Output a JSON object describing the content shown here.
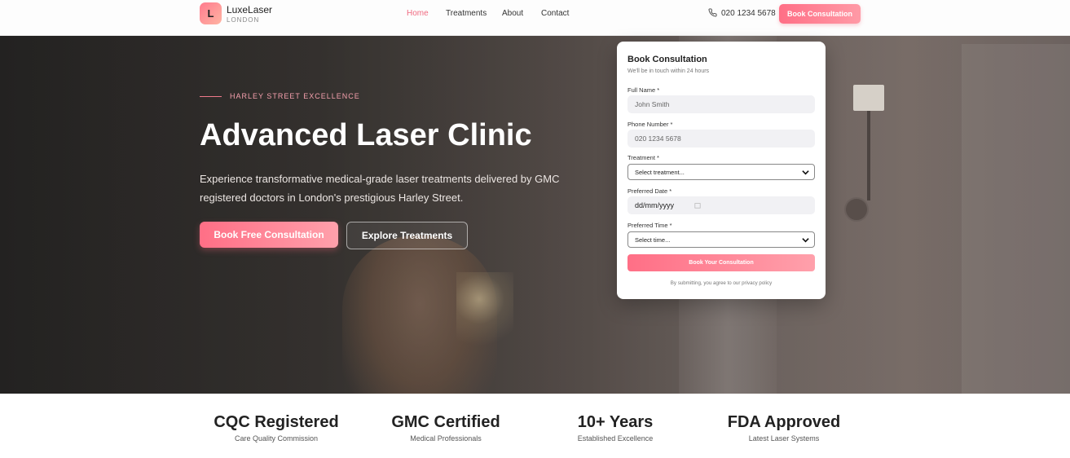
{
  "brand": {
    "logo_letter": "L",
    "name": "LuxeLaser",
    "location": "LONDON"
  },
  "nav": [
    {
      "label": "Home",
      "active": true
    },
    {
      "label": "Treatments",
      "active": false
    },
    {
      "label": "About",
      "active": false
    },
    {
      "label": "Contact",
      "active": false
    }
  ],
  "header": {
    "phone": "020 1234 5678",
    "cta_label": "Book Consultation"
  },
  "hero": {
    "eyebrow": "HARLEY STREET EXCELLENCE",
    "title": "Advanced Laser Clinic",
    "description": "Experience transformative medical-grade laser treatments delivered by GMC registered doctors in London's prestigious Harley Street.",
    "primary_button": "Book Free Consultation",
    "secondary_button": "Explore Treatments"
  },
  "form": {
    "title": "Book Consultation",
    "subtitle": "We'll be in touch within 24 hours",
    "fields": {
      "full_name": {
        "label": "Full Name *",
        "placeholder": "John Smith"
      },
      "phone": {
        "label": "Phone Number *",
        "placeholder": "020 1234 5678"
      },
      "treatment": {
        "label": "Treatment *",
        "selected": "Select treatment..."
      },
      "date": {
        "label": "Preferred Date *",
        "placeholder": "dd/mm/yyyy"
      },
      "time": {
        "label": "Preferred Time *",
        "selected": "Select time..."
      }
    },
    "submit_label": "Book Your Consultation",
    "privacy_note": "By submitting, you agree to our privacy policy"
  },
  "stats": [
    {
      "title": "CQC Registered",
      "subtitle": "Care Quality Commission"
    },
    {
      "title": "GMC Certified",
      "subtitle": "Medical Professionals"
    },
    {
      "title": "10+ Years",
      "subtitle": "Established Excellence"
    },
    {
      "title": "FDA Approved",
      "subtitle": "Latest Laser Systems"
    }
  ],
  "colors": {
    "accent": "#f06a80",
    "accent_light": "#ffa0ab",
    "hero_dark": "#2d2b2a"
  },
  "icons": {
    "phone": "phone-icon",
    "chevron": "chevron-down-icon",
    "calendar": "calendar-icon"
  }
}
